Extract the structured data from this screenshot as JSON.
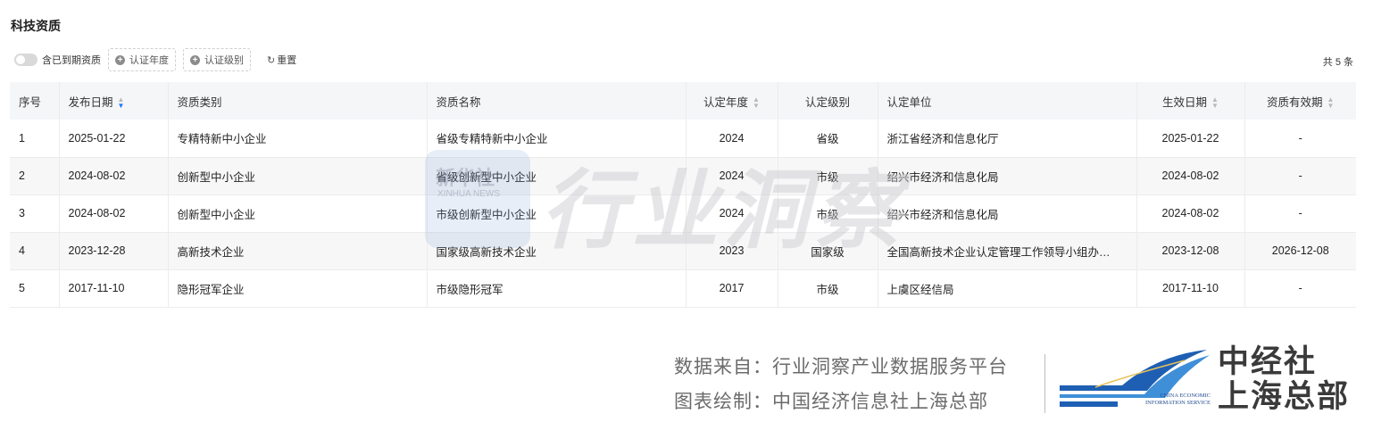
{
  "page": {
    "title": "科技资质"
  },
  "toolbar": {
    "toggle_label": "含已到期资质",
    "filter_year": "认证年度",
    "filter_level": "认证级别",
    "reset": "重置",
    "count": "共 5 条"
  },
  "table": {
    "headers": [
      "序号",
      "发布日期",
      "资质类别",
      "资质名称",
      "认定年度",
      "认定级别",
      "认定单位",
      "生效日期",
      "资质有效期"
    ],
    "rows": [
      [
        "1",
        "2025-01-22",
        "专精特新中小企业",
        "省级专精特新中小企业",
        "2024",
        "省级",
        "浙江省经济和信息化厅",
        "2025-01-22",
        "-"
      ],
      [
        "2",
        "2024-08-02",
        "创新型中小企业",
        "省级创新型中小企业",
        "2024",
        "市级",
        "绍兴市经济和信息化局",
        "2024-08-02",
        "-"
      ],
      [
        "3",
        "2024-08-02",
        "创新型中小企业",
        "市级创新型中小企业",
        "2024",
        "市级",
        "绍兴市经济和信息化局",
        "2024-08-02",
        "-"
      ],
      [
        "4",
        "2023-12-28",
        "高新技术企业",
        "国家级高新技术企业",
        "2023",
        "国家级",
        "全国高新技术企业认定管理工作领导小组办…",
        "2023-12-08",
        "2026-12-08"
      ],
      [
        "5",
        "2017-11-10",
        "隐形冠军企业",
        "市级隐形冠军",
        "2017",
        "市级",
        "上虞区经信局",
        "2017-11-10",
        "-"
      ]
    ]
  },
  "watermark": {
    "main": "行业洞察",
    "badge_cn": "新华社",
    "badge_en": "XINHUA NEWS"
  },
  "footer": {
    "source_line1": "数据来自：行业洞察产业数据服务平台",
    "source_line2": "图表绘制：中国经济信息社上海总部",
    "logo_en_line1": "CHINA ECONOMIC",
    "logo_en_line2": "INFORMATION SERVICE",
    "logo_cn_line1": "中经社",
    "logo_cn_line2": "上海总部"
  },
  "colors": {
    "sort_active": "#1677ff",
    "header_bg": "#f5f6f8",
    "logo_blue": "#1f4a8c"
  },
  "icons": {
    "toggle": "toggle-switch",
    "filter": "plus-circle-icon",
    "reset": "refresh-icon",
    "sort": "sort-caret-icon"
  }
}
